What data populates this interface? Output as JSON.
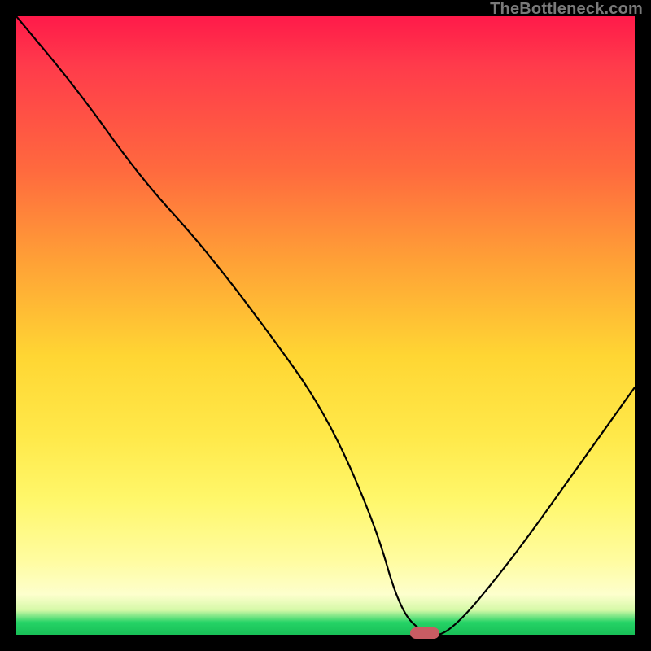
{
  "watermark": "TheBottleneck.com",
  "marker": {
    "x_pct": 66,
    "y_pct": 99.8
  },
  "chart_data": {
    "type": "line",
    "title": "",
    "xlabel": "",
    "ylabel": "",
    "xlim": [
      0,
      100
    ],
    "ylim": [
      0,
      100
    ],
    "grid": false,
    "legend": false,
    "background_gradient": [
      {
        "pct": 0,
        "color": "#ff1a4a"
      },
      {
        "pct": 25,
        "color": "#ff6a3e"
      },
      {
        "pct": 55,
        "color": "#ffd633"
      },
      {
        "pct": 88,
        "color": "#fffca0"
      },
      {
        "pct": 100,
        "color": "#18bf57"
      }
    ],
    "series": [
      {
        "name": "bottleneck-curve",
        "x": [
          0,
          10,
          20,
          30,
          40,
          50,
          58,
          62,
          66,
          70,
          80,
          90,
          100
        ],
        "y": [
          100,
          88,
          74,
          63,
          50,
          36,
          18,
          4,
          0,
          0,
          12,
          26,
          40
        ]
      }
    ],
    "annotations": [
      {
        "name": "optimal-marker",
        "x": 66,
        "y": 0,
        "style": "pill",
        "color": "#c85c63"
      }
    ]
  }
}
